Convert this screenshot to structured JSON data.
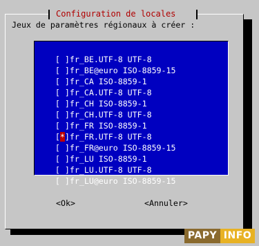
{
  "dialog": {
    "title": "Configuration de locales",
    "prompt": "Jeux de paramètres régionaux à créer :"
  },
  "locales": [
    {
      "checkbox": "[ ]",
      "mark": "",
      "label": "fr_BE.UTF-8 UTF-8",
      "selected": false
    },
    {
      "checkbox": "[ ]",
      "mark": "",
      "label": "fr_BE@euro ISO-8859-15",
      "selected": false
    },
    {
      "checkbox": "[ ]",
      "mark": "",
      "label": "fr_CA ISO-8859-1",
      "selected": false
    },
    {
      "checkbox": "[ ]",
      "mark": "",
      "label": "fr_CA.UTF-8 UTF-8",
      "selected": false
    },
    {
      "checkbox": "[ ]",
      "mark": "",
      "label": "fr_CH ISO-8859-1",
      "selected": false
    },
    {
      "checkbox": "[ ]",
      "mark": "",
      "label": "fr_CH.UTF-8 UTF-8",
      "selected": false
    },
    {
      "checkbox": "[ ]",
      "mark": "",
      "label": "fr_FR ISO-8859-1",
      "selected": false
    },
    {
      "checkbox": "[*]",
      "mark": "*",
      "label": "fr_FR.UTF-8 UTF-8",
      "selected": true
    },
    {
      "checkbox": "[ ]",
      "mark": "",
      "label": "fr_FR@euro ISO-8859-15",
      "selected": false
    },
    {
      "checkbox": "[ ]",
      "mark": "",
      "label": "fr_LU ISO-8859-1",
      "selected": false
    },
    {
      "checkbox": "[ ]",
      "mark": "",
      "label": "fr_LU.UTF-8 UTF-8",
      "selected": false
    },
    {
      "checkbox": "[ ]",
      "mark": "",
      "label": "fr_LU@euro ISO-8859-15",
      "selected": false
    }
  ],
  "buttons": {
    "ok": "<Ok>",
    "cancel": "<Annuler>"
  },
  "watermark": {
    "part1": "PAPY",
    "part2": "INFO"
  },
  "colors": {
    "background": "#c6c6c6",
    "list_background": "#0000c0",
    "title_text": "#b00000",
    "selection_mark": "#c00000",
    "logo_dark": "#8a6a2e",
    "logo_light": "#e8b224"
  }
}
